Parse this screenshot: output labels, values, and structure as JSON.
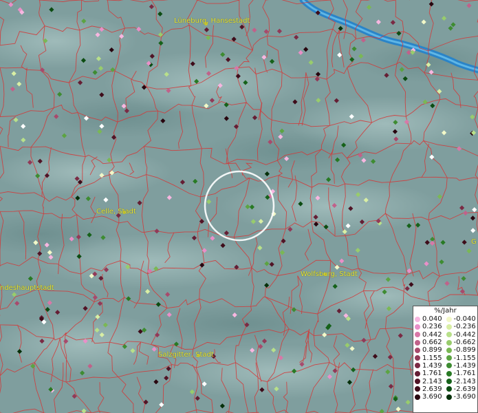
{
  "map": {
    "labels": {
      "lueneburg": "Lüneburg, Hansestadt",
      "celle": "Celle, Stadt",
      "landeshauptstadt": "ndeshauptstadt",
      "wolfsburg": "Wolfsburg, Stadt",
      "salzgitter": "Salzgitter, Stadt",
      "edge_g": "G"
    },
    "colors": {
      "background": "#7f9e9e",
      "borders": "#d23a3a",
      "river": "#2a84c8",
      "label": "#e6e63a"
    }
  },
  "legend": {
    "title": "%/Jahr",
    "positive": [
      {
        "value": "0.040",
        "color": "#f7b6e0"
      },
      {
        "value": "0.236",
        "color": "#e98fc8"
      },
      {
        "value": "0.442",
        "color": "#d878a8"
      },
      {
        "value": "0.662",
        "color": "#c0628a"
      },
      {
        "value": "0.899",
        "color": "#a84a6c"
      },
      {
        "value": "1.155",
        "color": "#923a58"
      },
      {
        "value": "1.439",
        "color": "#7a2a44"
      },
      {
        "value": "1.761",
        "color": "#651e34"
      },
      {
        "value": "2.143",
        "color": "#511426"
      },
      {
        "value": "2.639",
        "color": "#3e0c1a"
      },
      {
        "value": "3.690",
        "color": "#28060f"
      }
    ],
    "negative": [
      {
        "value": "-0.040",
        "color": "#f2f8c8"
      },
      {
        "value": "-0.236",
        "color": "#d8eea4"
      },
      {
        "value": "-0.442",
        "color": "#b8e08a"
      },
      {
        "value": "-0.662",
        "color": "#98cc6c"
      },
      {
        "value": "-0.899",
        "color": "#7ab854"
      },
      {
        "value": "-1.155",
        "color": "#5ca442"
      },
      {
        "value": "-1.439",
        "color": "#3e8c32"
      },
      {
        "value": "-1.761",
        "color": "#287a24"
      },
      {
        "value": "-2.143",
        "color": "#16621a"
      },
      {
        "value": "-2.639",
        "color": "#0c4c12"
      },
      {
        "value": "-3.690",
        "color": "#06300a"
      }
    ]
  }
}
